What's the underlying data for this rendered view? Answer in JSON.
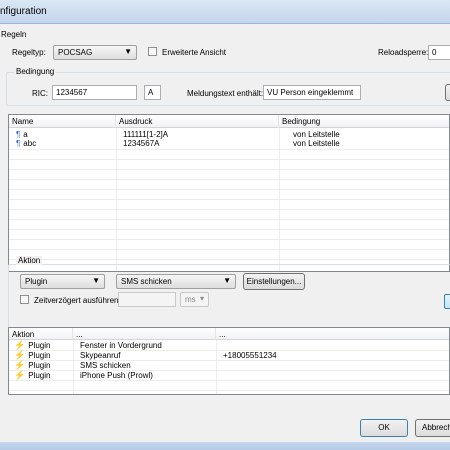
{
  "window": {
    "title": "nfiguration"
  },
  "regeln": {
    "group_label": "Regeln",
    "regeltyp_label": "Regeltyp:",
    "regeltyp_value": "POCSAG",
    "erweiterte_label": "Erweiterte Ansicht",
    "reload_label": "Reloadsperre:",
    "reload_value": "0",
    "bedingung_group_label": "Bedingung",
    "ric_label": "RIC:",
    "ric_value": "1234567",
    "ric_suffix": "A",
    "meldungstext_label": "Meldungstext enthält:",
    "meldungstext_value": "VU Person eingeklemmt"
  },
  "rules_table": {
    "columns": [
      "Name",
      "Ausdruck",
      "Bedingung"
    ],
    "rows": [
      {
        "name": "a",
        "ausdruck": "111111[1-2]A",
        "bedingung": "von Leitstelle"
      },
      {
        "name": "abc",
        "ausdruck": "1234567A",
        "bedingung": "von Leitstelle"
      }
    ]
  },
  "aktion": {
    "group_label": "Aktion",
    "type_value": "Plugin",
    "plugin_value": "SMS schicken",
    "settings_button": "Einstellungen...",
    "zeitverzoegert_label": "Zeitverzögert ausführen",
    "unit_value": "ms"
  },
  "actions_table": {
    "columns": [
      "Aktion",
      "...",
      "..."
    ],
    "rows": [
      {
        "aktion": "Plugin",
        "col2": "Fenster in Vordergrund",
        "col3": ""
      },
      {
        "aktion": "Plugin",
        "col2": "Skypeanruf",
        "col3": "+18005551234"
      },
      {
        "aktion": "Plugin",
        "col2": "SMS schicken",
        "col3": ""
      },
      {
        "aktion": "Plugin",
        "col2": "iPhone Push (Prowl)",
        "col3": ""
      }
    ]
  },
  "footer": {
    "ok_label": "OK",
    "cancel_label": "Abbrech"
  },
  "icons": {
    "rule": "flag-icon",
    "action": "bolt-icon"
  }
}
